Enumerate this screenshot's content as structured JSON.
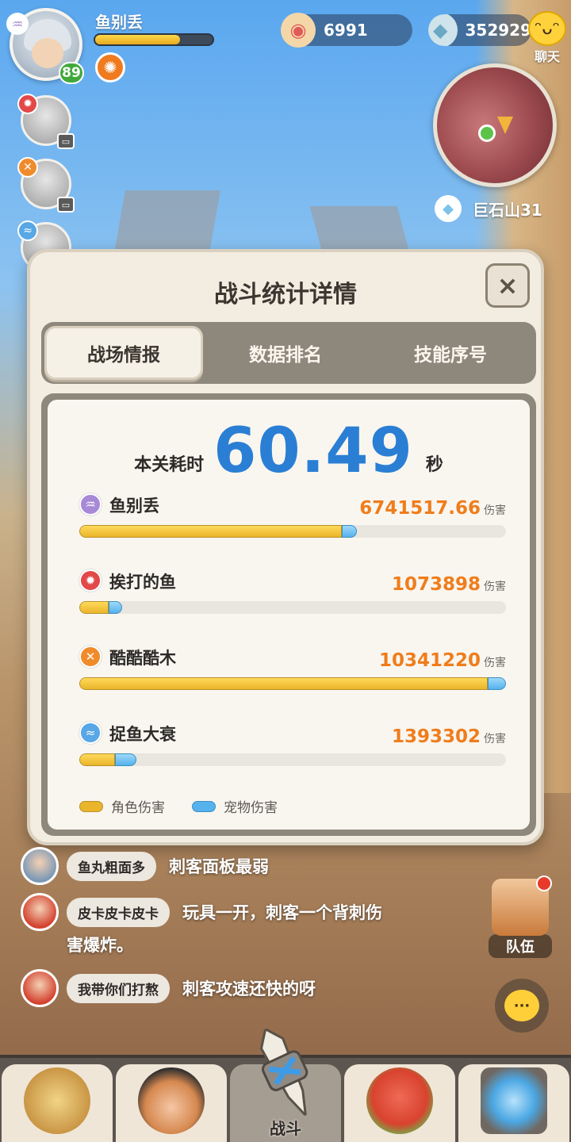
{
  "player": {
    "name": "鱼别丢",
    "level": "89",
    "hp_fraction": 0.72
  },
  "currencies": [
    {
      "icon": "pearl-shell-icon",
      "value": "6991"
    },
    {
      "icon": "shell-gem-icon",
      "value": "352929"
    }
  ],
  "chat_button_label": "聊天",
  "location": {
    "name": "巨石山31"
  },
  "modal": {
    "title": "战斗统计详情",
    "close": "×",
    "tabs": [
      {
        "label": "战场情报",
        "active": true
      },
      {
        "label": "数据排名",
        "active": false
      },
      {
        "label": "技能序号",
        "active": false
      }
    ],
    "time_label": "本关耗时",
    "time_value": "60.49",
    "time_unit": "秒",
    "damage_unit": "伤害",
    "players": [
      {
        "name": "鱼别丢",
        "damage": "6741517.66",
        "element_icon": "wind-swirl-icon",
        "element_color": "#a889d8",
        "char_fraction": 0.615,
        "pet_fraction": 0.035
      },
      {
        "name": "挨打的鱼",
        "damage": "1073898",
        "element_icon": "fire-icon",
        "element_color": "#e24848",
        "char_fraction": 0.068,
        "pet_fraction": 0.033
      },
      {
        "name": "酷酷酷木",
        "damage": "10341220",
        "element_icon": "sword-cross-icon",
        "element_color": "#f08b2b",
        "char_fraction": 0.957,
        "pet_fraction": 0.043
      },
      {
        "name": "捉鱼大衰",
        "damage": "1393302",
        "element_icon": "water-wave-icon",
        "element_color": "#58a7e6",
        "char_fraction": 0.083,
        "pet_fraction": 0.05
      }
    ],
    "legend": [
      {
        "label": "角色伤害",
        "color": "#eab52a"
      },
      {
        "label": "宠物伤害",
        "color": "#55b2ec"
      }
    ]
  },
  "chat": [
    {
      "tag": "鱼丸粗面多",
      "message": "刺客面板最弱"
    },
    {
      "tag": "皮卡皮卡皮卡",
      "message": "玩具一开，刺客一个背刺伤",
      "message_cont": "害爆炸。"
    },
    {
      "tag": "我带你们打熬",
      "message": "刺客攻速还快的呀"
    }
  ],
  "team_button_label": "队伍",
  "chat_float_icon": "···",
  "nav": [
    {
      "name": "nav-item-character",
      "label": ""
    },
    {
      "name": "nav-item-hero",
      "label": ""
    },
    {
      "name": "nav-item-battle",
      "label": "战斗"
    },
    {
      "name": "nav-item-pet",
      "label": ""
    },
    {
      "name": "nav-item-portal",
      "label": ""
    }
  ]
}
